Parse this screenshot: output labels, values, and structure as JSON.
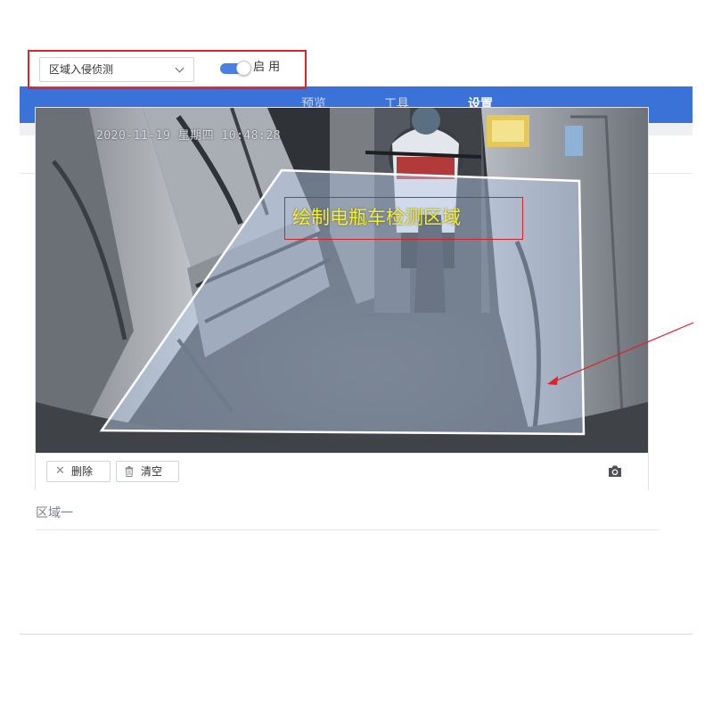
{
  "nav": {
    "tabs": [
      {
        "label": "预览"
      },
      {
        "label": "工具"
      },
      {
        "label": "设置"
      }
    ],
    "active_tab": "设置"
  },
  "toolbar": {
    "detection_select": {
      "value": "区域入侵侦测"
    },
    "enable_toggle": {
      "label": "启 用",
      "state": "on"
    }
  },
  "video": {
    "timestamp": "2020-11-19 星期四 10:48:28",
    "annotation": "绘制电瓶车检测区域"
  },
  "controls": {
    "delete_label": "删除",
    "clear_label": "清空",
    "snapshot_icon": "camera-icon",
    "delete_icon": "close-icon",
    "clear_icon": "trash-icon"
  },
  "region": {
    "label": "区域一"
  },
  "colors": {
    "nav_bg": "#3a72d8",
    "highlight": "#e0202a",
    "toggle_on": "#4a7fe6",
    "annotation_text": "#f5f22a"
  }
}
